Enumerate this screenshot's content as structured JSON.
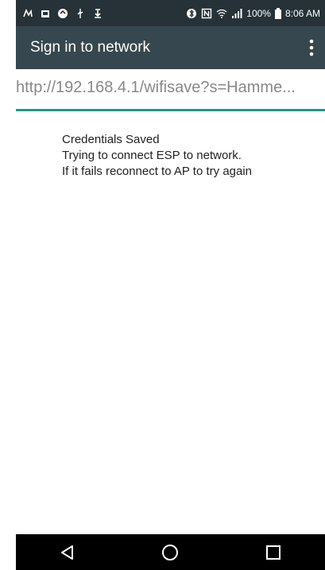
{
  "status_bar": {
    "battery": "100%",
    "time": "8:06 AM",
    "icons": [
      "app-icon",
      "photo-icon",
      "sync-icon",
      "usb-icon",
      "download-icon",
      "bluetooth-icon",
      "nfc-icon",
      "wifi-icon",
      "signal-icon",
      "battery-icon"
    ]
  },
  "app_bar": {
    "title": "Sign in to network",
    "menu_icon": "more-vert-icon"
  },
  "url_bar": {
    "url": "http://192.168.4.1/wifisave?s=Hamme..."
  },
  "content": {
    "line1": "Credentials Saved",
    "line2": "Trying to connect ESP to network.",
    "line3": "If it fails reconnect to AP to try again"
  },
  "nav_bar": {
    "icons": [
      "back-icon",
      "home-icon",
      "recents-icon"
    ]
  },
  "colors": {
    "status_bar": "#263238",
    "app_bar": "#37474f",
    "accent": "#1a9a88",
    "nav_bar": "#000000"
  }
}
